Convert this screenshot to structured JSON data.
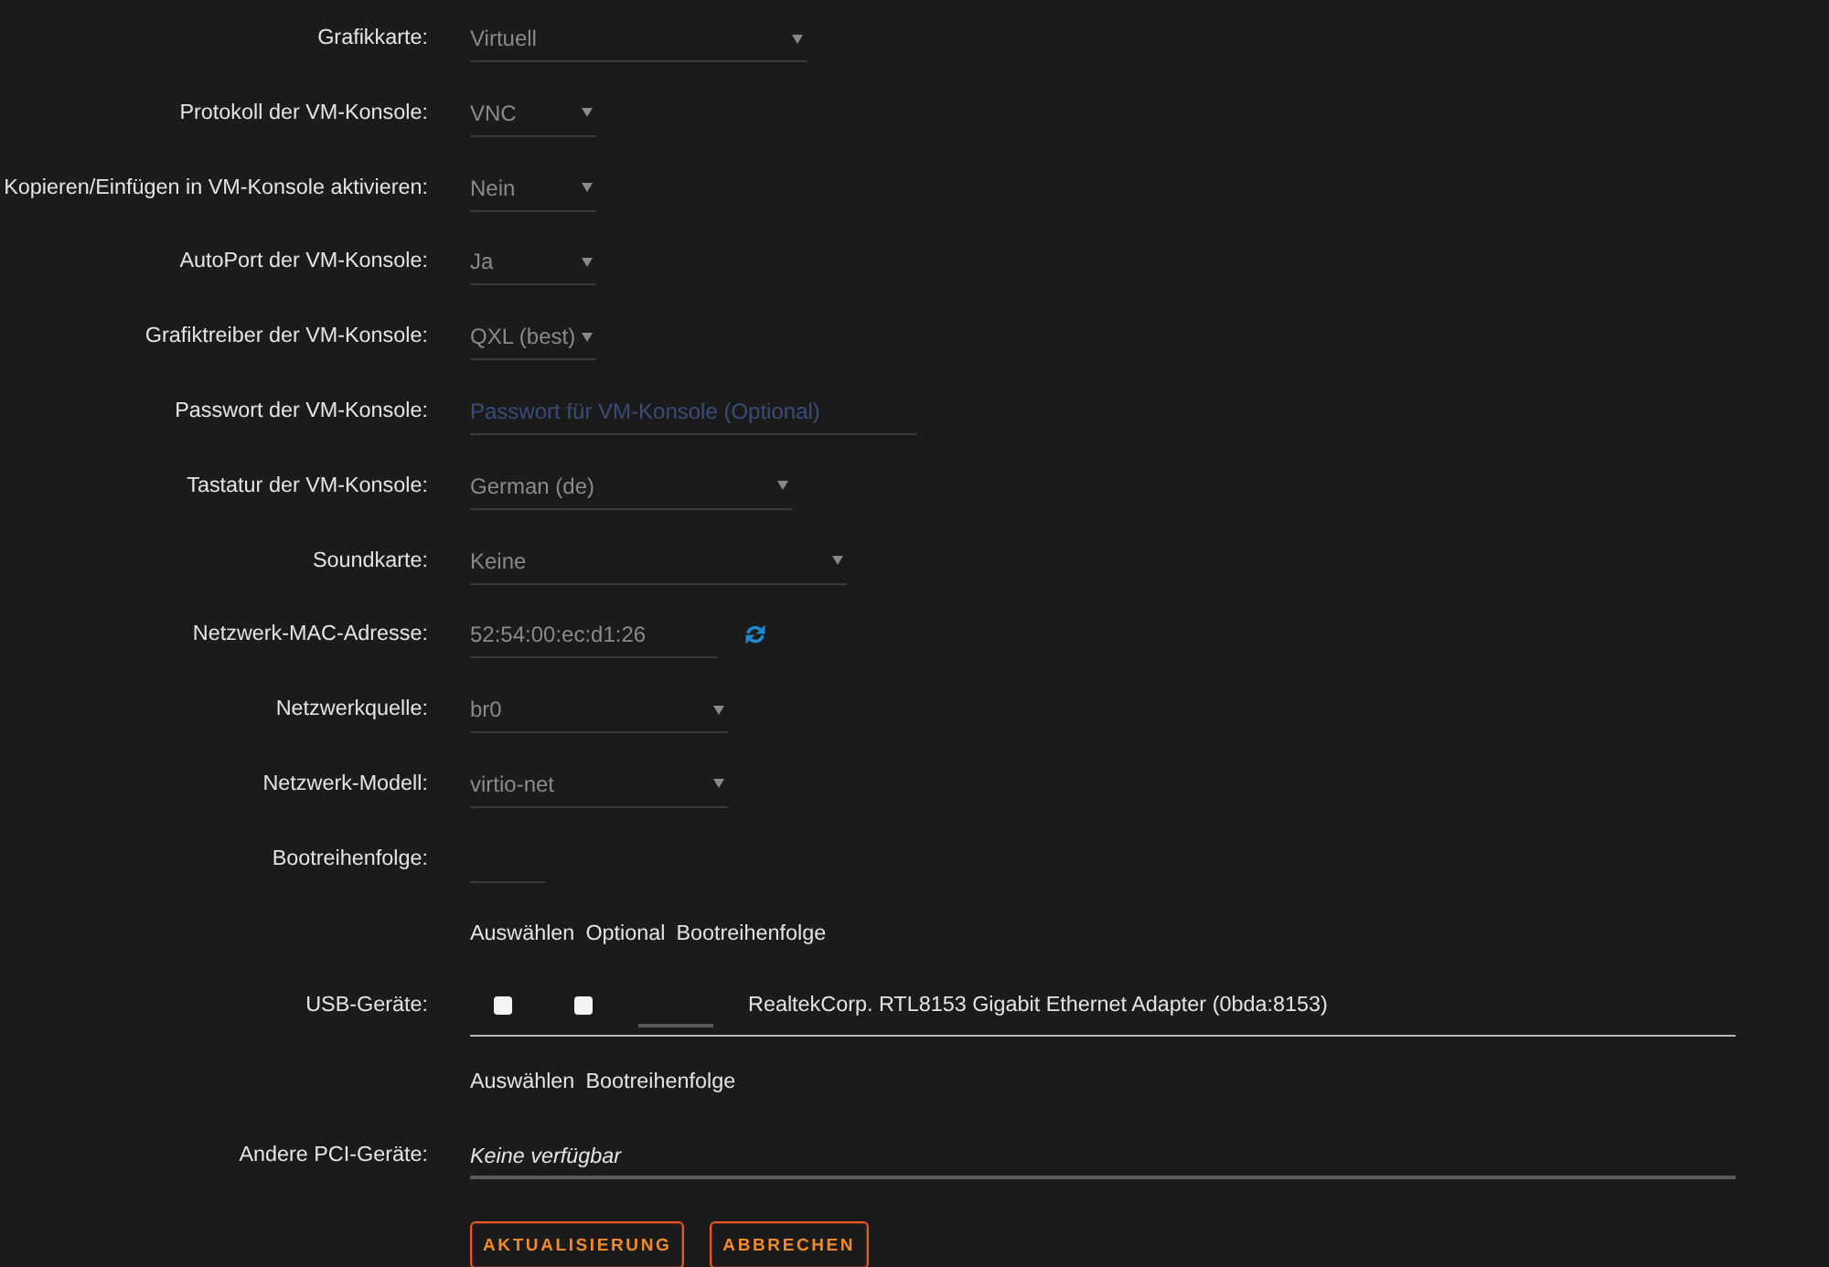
{
  "fields": [
    {
      "label": "Grafikkarte:",
      "kind": "select",
      "value": "Virtuell"
    },
    {
      "label": "Protokoll der VM-Konsole:",
      "kind": "select",
      "value": "VNC"
    },
    {
      "label": "Kopieren/Einfügen in VM-Konsole aktivieren:",
      "kind": "select",
      "value": "Nein"
    },
    {
      "label": "AutoPort der VM-Konsole:",
      "kind": "select",
      "value": "Ja"
    },
    {
      "label": "Grafiktreiber der VM-Konsole:",
      "kind": "select",
      "value": "QXL (best)"
    },
    {
      "label": "Passwort der VM-Konsole:",
      "kind": "password",
      "placeholder": "Passwort für VM-Konsole (Optional)"
    },
    {
      "label": "Tastatur der VM-Konsole:",
      "kind": "select",
      "value": "German (de)"
    },
    {
      "label": "Soundkarte:",
      "kind": "select",
      "value": "Keine"
    },
    {
      "label": "Netzwerk-MAC-Adresse:",
      "kind": "mac",
      "value": "52:54:00:ec:d1:26"
    },
    {
      "label": "Netzwerkquelle:",
      "kind": "select",
      "value": "br0"
    },
    {
      "label": "Netzwerk-Modell:",
      "kind": "select",
      "value": "virtio-net"
    },
    {
      "label": "Bootreihenfolge:",
      "kind": "order"
    }
  ],
  "usb": {
    "columns": [
      "Auswählen",
      "Optional",
      "Bootreihenfolge"
    ],
    "label": "USB-Geräte:",
    "devices": [
      {
        "checked": false,
        "optional_checked": false,
        "name": "RealtekCorp. RTL8153 Gigabit Ethernet Adapter (0bda:8153)"
      }
    ]
  },
  "pci": {
    "columns": [
      "Auswählen",
      "Bootreihenfolge"
    ],
    "label": "Andere PCI-Geräte:",
    "empty_text": "Keine verfügbar"
  },
  "buttons": [
    "AKTUALISIERUNG",
    "ABBRECHEN"
  ]
}
